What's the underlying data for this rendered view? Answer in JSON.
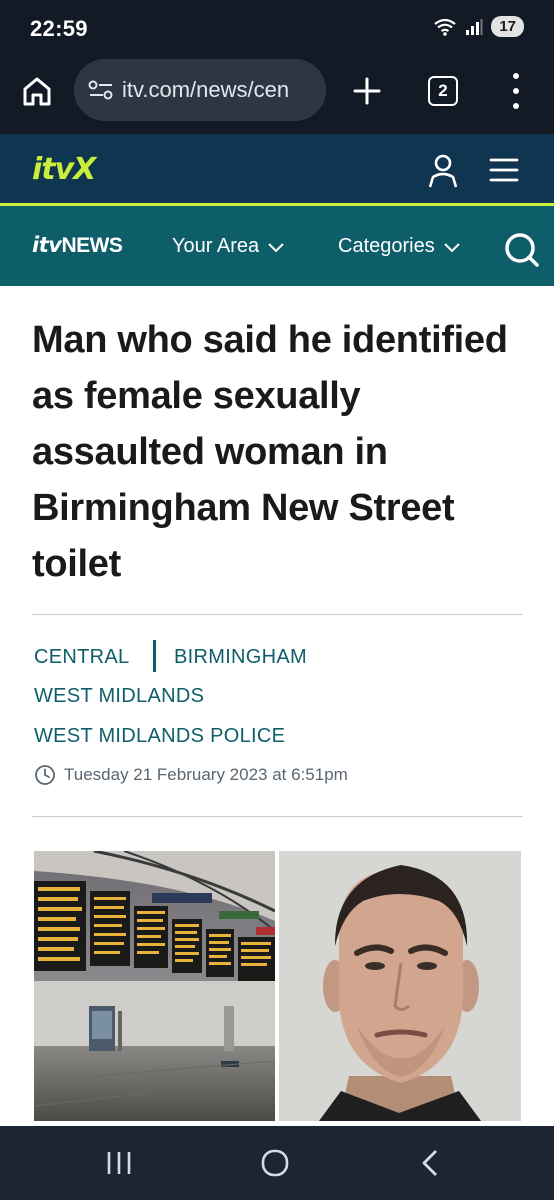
{
  "status_bar": {
    "time": "22:59",
    "battery": "17",
    "icons": [
      "wifi-icon",
      "signal-icon",
      "battery-icon"
    ]
  },
  "browser": {
    "url": "itv.com/news/cen",
    "tab_count": "2",
    "icons": [
      "home-icon",
      "site-settings-icon",
      "plus-icon",
      "more-vert-icon"
    ]
  },
  "itvx_header": {
    "logo": "itvX",
    "icons": [
      "account-icon",
      "hamburger-icon"
    ],
    "colors": {
      "background": "#0f3550",
      "accent": "#c9ef3b"
    }
  },
  "news_nav": {
    "logo_itv": "itv",
    "logo_news": "NEWS",
    "your_area": "Your Area",
    "categories": "Categories",
    "icons": [
      "chevron-down-icon",
      "search-icon"
    ],
    "colors": {
      "background": "#0e5e6a"
    }
  },
  "article": {
    "headline": "Man who said he identified as female sexually assaulted woman in Birmingham New Street toilet",
    "tags": [
      "CENTRAL",
      "BIRMINGHAM",
      "WEST MIDLANDS",
      "WEST MIDLANDS POLICE"
    ],
    "timestamp": "Tuesday 21 February 2023 at 6:51pm",
    "images": [
      "train-station-concourse-photo",
      "man-mugshot-photo"
    ]
  },
  "system_nav": {
    "icons": [
      "recents-icon",
      "home-circle-icon",
      "back-icon"
    ]
  }
}
